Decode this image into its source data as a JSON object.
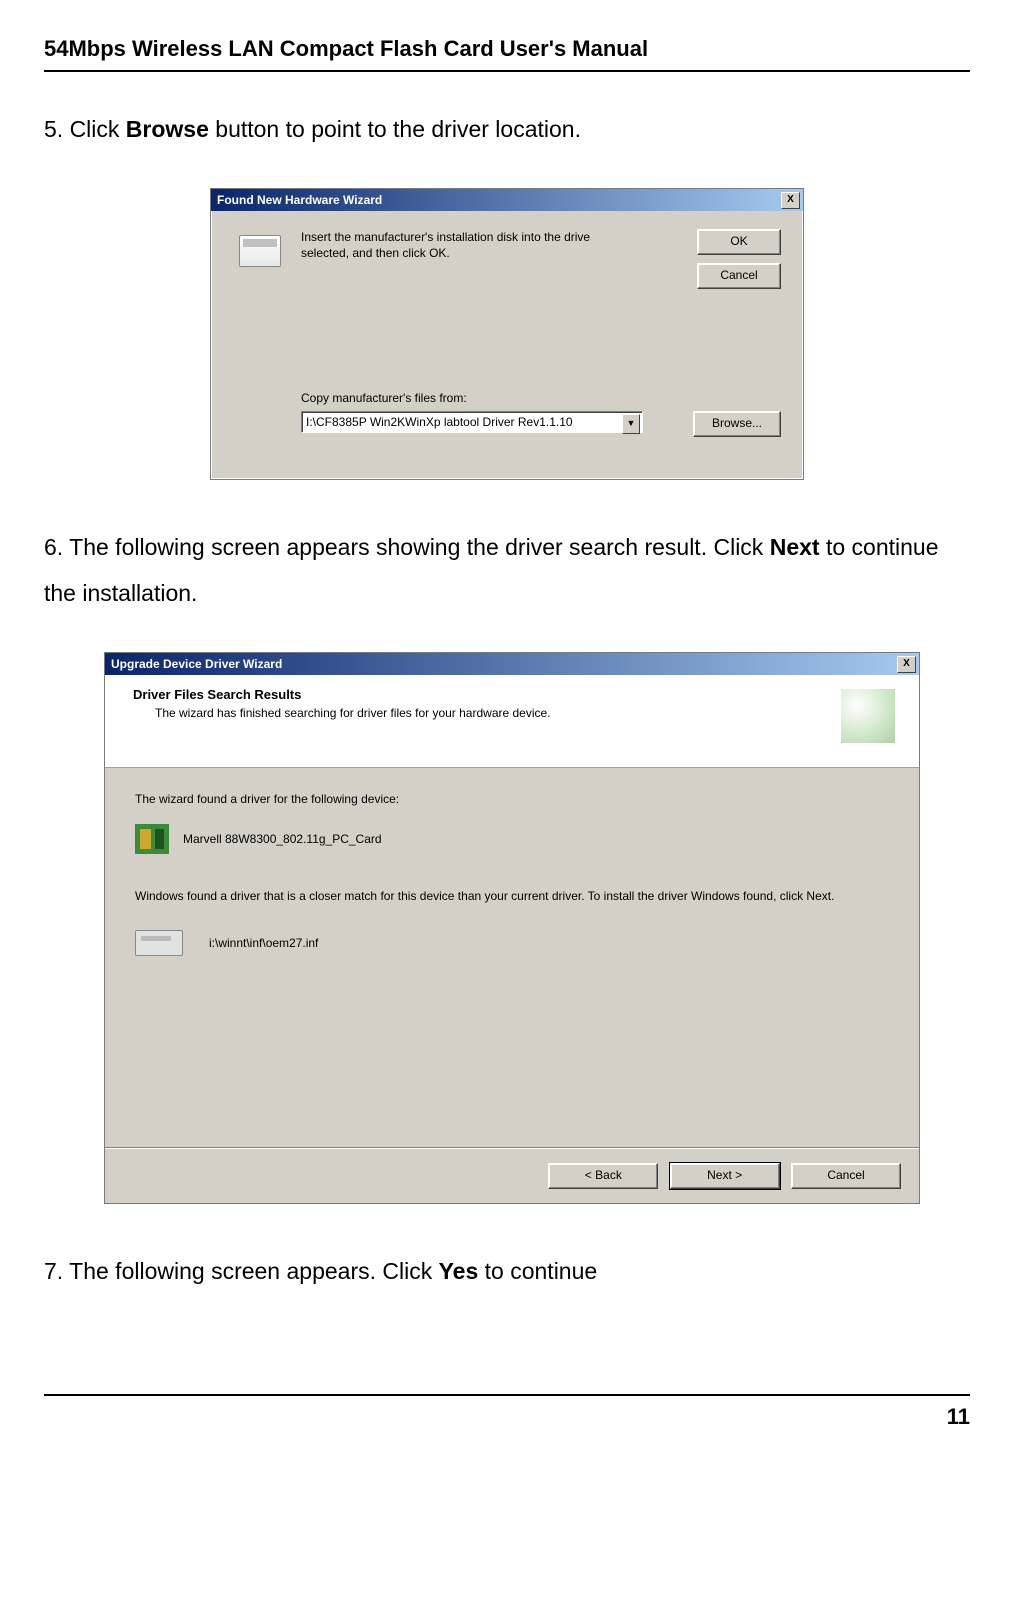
{
  "page": {
    "doc_title": "54Mbps Wireless LAN Compact Flash Card User's Manual",
    "page_number": "11"
  },
  "steps": {
    "s5_prefix": "5.  Click ",
    "s5_bold": "Browse",
    "s5_suffix": " button to point to the driver location.",
    "s6_prefix": "6.  The  following  screen  appears  showing  the  driver  search  result.  Click  ",
    "s6_bold": "Next",
    "s6_suffix": "  to continue the installation.",
    "s7_prefix": "7.  The following screen appears. Click ",
    "s7_bold": "Yes",
    "s7_suffix": " to continue"
  },
  "dlg1": {
    "title": "Found New Hardware Wizard",
    "close": "X",
    "msg": "Insert the manufacturer's installation disk into the drive selected, and then click OK.",
    "ok": "OK",
    "cancel": "Cancel",
    "copy_label": "Copy manufacturer's files from:",
    "path_value": "I:\\CF8385P Win2KWinXp labtool Driver Rev1.1.10",
    "dd": "▼",
    "browse": "Browse..."
  },
  "dlg2": {
    "titlebar": "Upgrade Device Driver Wizard",
    "close": "X",
    "head_title": "Driver Files Search Results",
    "head_sub": "The wizard has finished searching for driver files for your hardware device.",
    "found_device_label": "The wizard found a driver for the following device:",
    "device_name": "Marvell 88W8300_802.11g_PC_Card",
    "desc": "Windows found a driver that is a closer match for this device than your current driver. To install the driver Windows found, click Next.",
    "inf_path": "i:\\winnt\\inf\\oem27.inf",
    "back": "< Back",
    "next": "Next >",
    "cancel": "Cancel"
  }
}
